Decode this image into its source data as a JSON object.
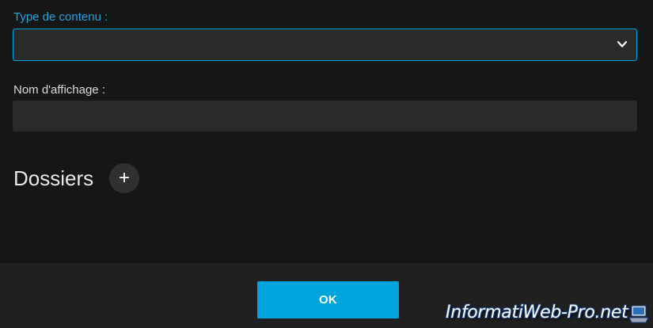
{
  "form": {
    "content_type": {
      "label": "Type de contenu :",
      "selected_value": ""
    },
    "display_name": {
      "label": "Nom d'affichage :",
      "value": "",
      "placeholder": ""
    },
    "folders": {
      "title": "Dossiers",
      "add_label": "+"
    }
  },
  "footer": {
    "ok_label": "OK"
  },
  "watermark": {
    "text": "InformatiWeb-Pro.net",
    "icon": "laptop-icon"
  },
  "colors": {
    "accent": "#00a4dc",
    "background": "#161616",
    "input_background": "#2a2a2a",
    "footer_background": "#202020"
  },
  "icons": {
    "select_chevron": "chevron-down-icon",
    "add": "plus-icon"
  }
}
